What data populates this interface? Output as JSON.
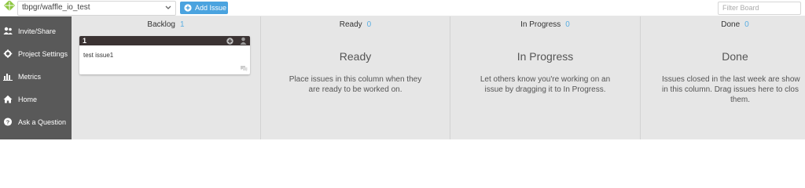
{
  "header": {
    "repo_name": "tbpgr/waffle_io_test",
    "add_issue_label": "Add Issue",
    "filter_placeholder": "Filter Board"
  },
  "sidebar": {
    "items": [
      {
        "label": "Invite/Share",
        "icon": "users-icon"
      },
      {
        "label": "Project Settings",
        "icon": "gear-icon"
      },
      {
        "label": "Metrics",
        "icon": "bar-chart-icon"
      },
      {
        "label": "Home",
        "icon": "home-icon"
      },
      {
        "label": "Ask a Question",
        "icon": "question-icon"
      }
    ]
  },
  "columns": [
    {
      "name": "Backlog",
      "count": "1",
      "title": "",
      "description": []
    },
    {
      "name": "Ready",
      "count": "0",
      "title": "Ready",
      "description": [
        "Place issues in this column when they",
        "are ready to be worked on."
      ]
    },
    {
      "name": "In Progress",
      "count": "0",
      "title": "In Progress",
      "description": [
        "Let others know you're working on an",
        "issue by dragging it to In Progress."
      ]
    },
    {
      "name": "Done",
      "count": "0",
      "title": "Done",
      "description": [
        "Issues closed in the last week are show",
        "in this column. Drag issues here to clos",
        "them."
      ]
    }
  ],
  "card": {
    "number": "1",
    "title": "test issue1"
  },
  "colors": {
    "sidebar_bg": "#595959",
    "board_bg": "#e6e6e6",
    "accent": "#4aa3df",
    "card_header": "#3b3333"
  }
}
